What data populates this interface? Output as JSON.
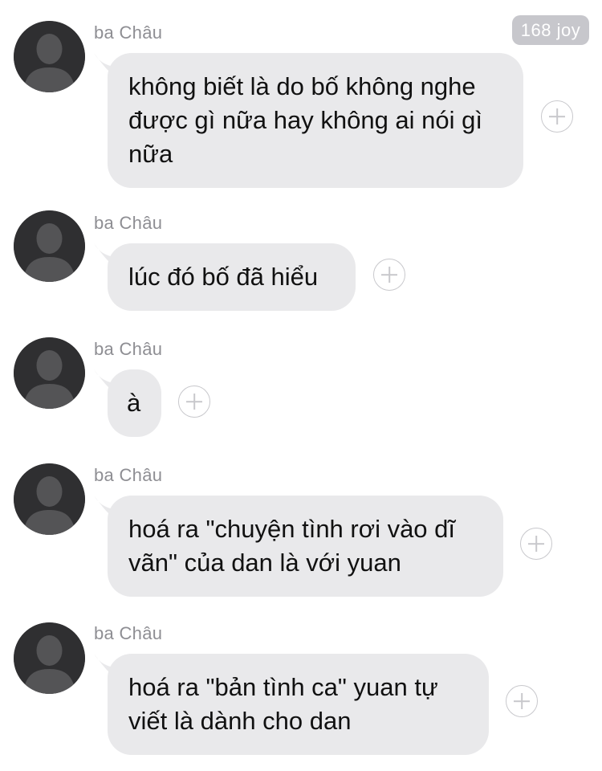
{
  "header": {
    "badge": "168 joy"
  },
  "messages": [
    {
      "sender": "ba Châu",
      "text": "không biết là do bố không nghe được gì nữa hay không ai nói gì nữa"
    },
    {
      "sender": "ba Châu",
      "text": "lúc đó bố đã hiểu"
    },
    {
      "sender": "ba Châu",
      "text": "à"
    },
    {
      "sender": "ba Châu",
      "text": "hoá ra \"chuyện tình rơi vào dĩ vãn\" của dan là với yuan"
    },
    {
      "sender": "ba Châu",
      "text": "hoá ra \"bản tình ca\" yuan tự viết là dành cho dan"
    }
  ],
  "icons": {
    "avatar": "default-person-avatar-icon",
    "add_reaction": "plus-circle-icon"
  },
  "colors": {
    "bubble": "#e9e9eb",
    "badge": "#c7c7cc",
    "sender_text": "#8e8e93",
    "avatar_bg": "#2f2f31"
  }
}
